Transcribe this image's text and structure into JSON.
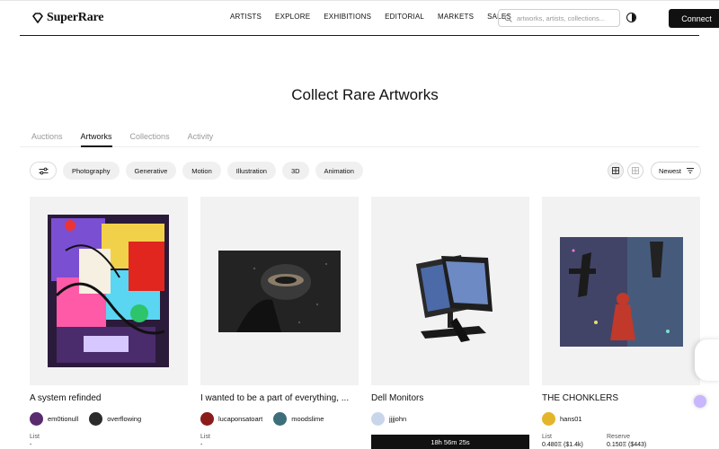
{
  "header": {
    "logo_text": "SuperRare",
    "nav": [
      "ARTISTS",
      "EXPLORE",
      "EXHIBITIONS",
      "EDITORIAL",
      "MARKETS",
      "SALES"
    ],
    "search_placeholder": "artworks, artists, collections...",
    "connect_label": "Connect"
  },
  "page_title": "Collect Rare Artworks",
  "tabs": [
    {
      "label": "Auctions",
      "active": false
    },
    {
      "label": "Artworks",
      "active": true
    },
    {
      "label": "Collections",
      "active": false
    },
    {
      "label": "Activity",
      "active": false
    }
  ],
  "filters": [
    "Photography",
    "Generative",
    "Motion",
    "Illustration",
    "3D",
    "Animation"
  ],
  "sort": {
    "label": "Newest"
  },
  "cards": [
    {
      "title": "A system refinded",
      "people": [
        {
          "name": "em0tionull",
          "color": "#5a2a6e"
        },
        {
          "name": "overflowing",
          "color": "#2b2b2b"
        }
      ],
      "list_label": "List",
      "list_value": "-"
    },
    {
      "title": "I wanted to be a part of everything, ...",
      "people": [
        {
          "name": "lucaponsatoart",
          "color": "#8a1c1c"
        },
        {
          "name": "moodslime",
          "color": "#3d6e7a"
        }
      ],
      "list_label": "List",
      "list_value": "-"
    },
    {
      "title": "Dell Monitors",
      "people": [
        {
          "name": "jjjjohn",
          "color": "#c9d6ea"
        }
      ],
      "timer": "18h 56m 25s"
    },
    {
      "title": "THE CHONKLERS",
      "people": [
        {
          "name": "hans01",
          "color": "#e3b52a"
        }
      ],
      "list_label": "List",
      "list_value": "0.480Ξ ($1.4k)",
      "reserve_label": "Reserve",
      "reserve_value": "0.150Ξ ($443)"
    }
  ],
  "colors": {
    "accent": "#111111",
    "card_bg": "#f2f2f2",
    "pill_bg": "#f0f0f0"
  }
}
